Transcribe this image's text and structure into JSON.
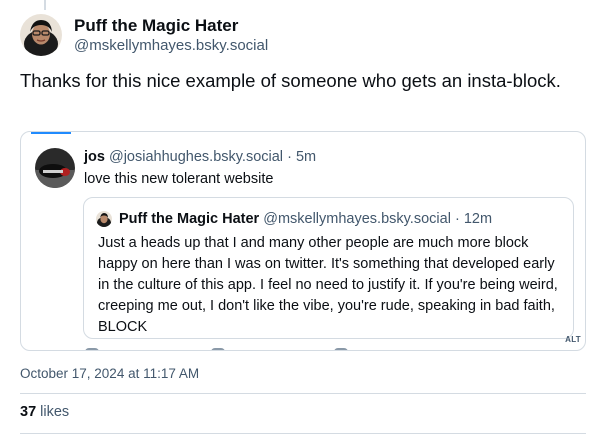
{
  "post": {
    "author_name": "Puff the Magic Hater",
    "author_handle": "@mskellymhayes.bsky.social",
    "text": "Thanks for this nice example of someone who gets an insta-block.",
    "timestamp": "October 17, 2024 at 11:17 AM",
    "likes_count": "37",
    "likes_label": "likes"
  },
  "quote": {
    "author_name": "jos",
    "author_handle": "@josiahhughes.bsky.social",
    "time_ago": "5m",
    "text": "love this new tolerant website"
  },
  "inner_quote": {
    "author_name": "Puff the Magic Hater",
    "author_handle": "@mskellymhayes.bsky.social",
    "time_ago": "12m",
    "text": "Just a heads up that I and many other people are much more block happy on here than I was on twitter. It's something that developed early in the culture of this app. I feel no need to justify it. If you're being weird, creeping me out, I don't like the vibe, you're rude, speaking in bad faith, BLOCK",
    "alt_badge": "ALT"
  },
  "colors": {
    "accent": "#208bfe",
    "muted_text": "#42576c",
    "border": "#d4dbe2"
  }
}
